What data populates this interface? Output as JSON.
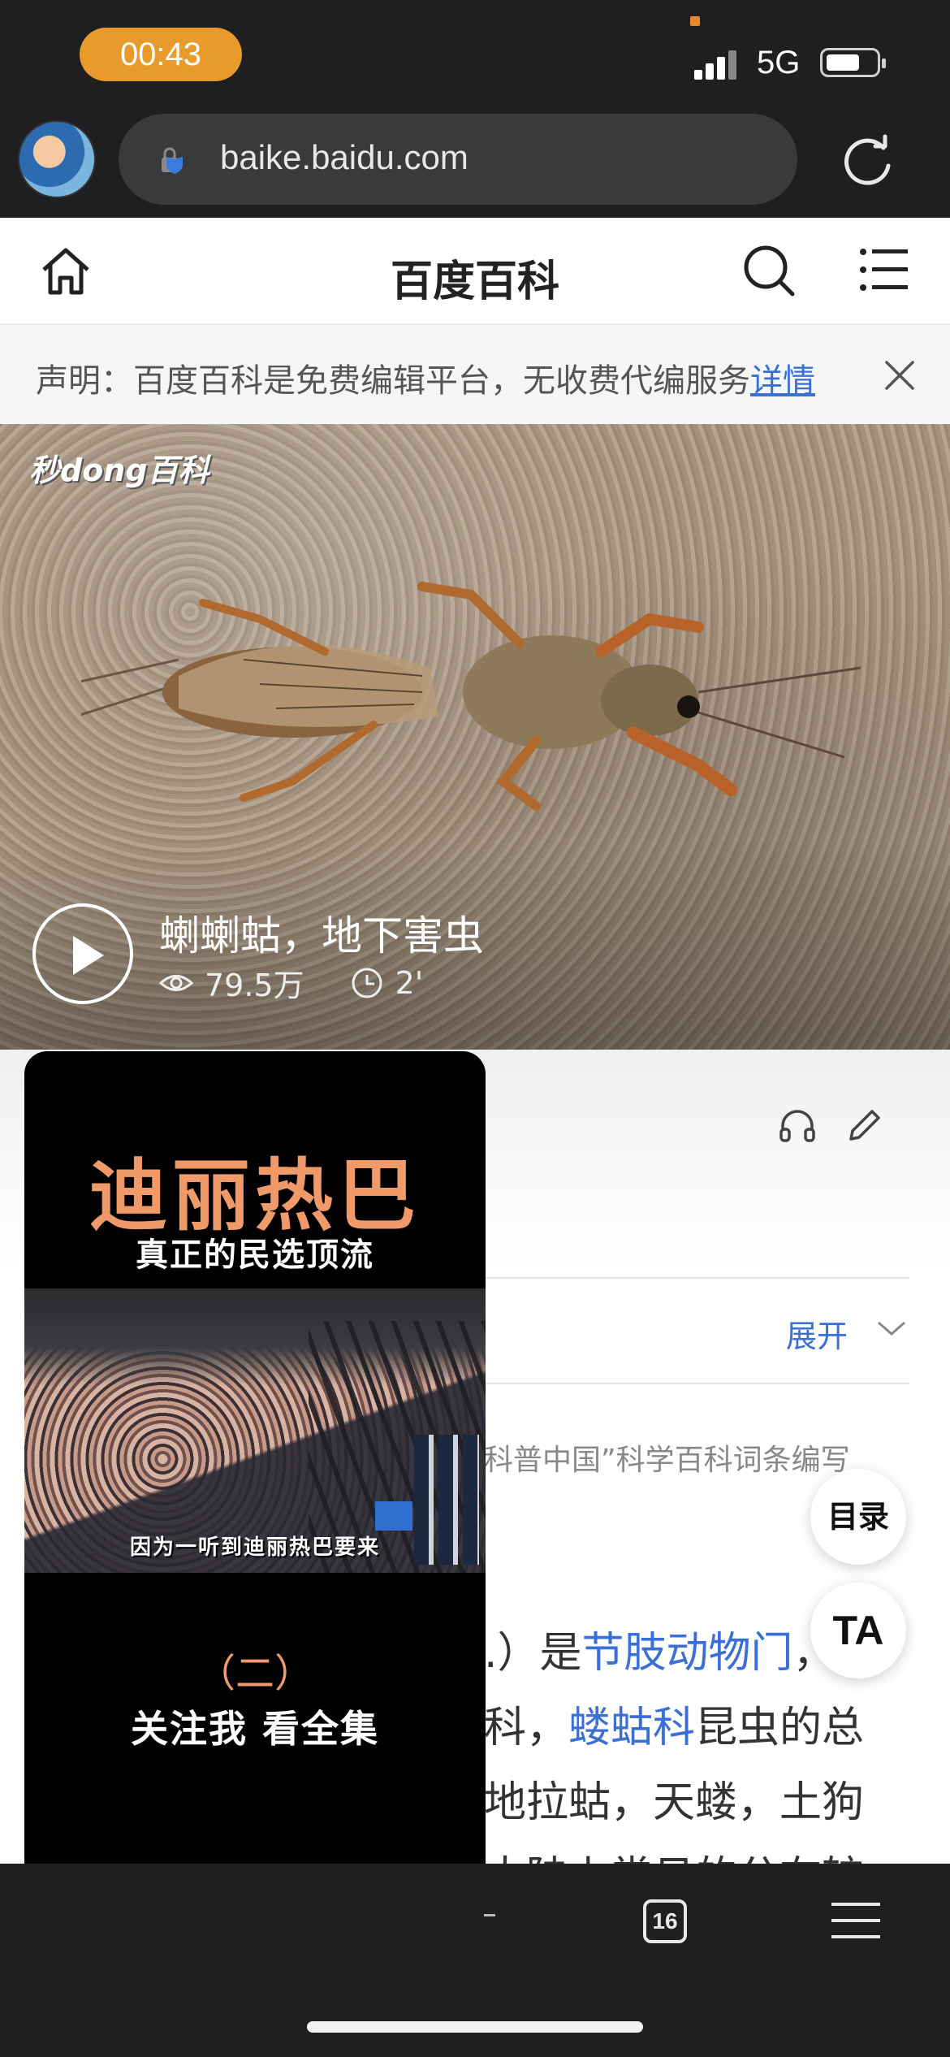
{
  "status": {
    "time": "00:43",
    "network": "5G"
  },
  "browser": {
    "url": "baike.baidu.com",
    "tab_count": "16"
  },
  "header": {
    "title": "百度百科"
  },
  "notice": {
    "text": "声明：百度百科是免费编辑平台，无收费代编服务",
    "link": "详情"
  },
  "video": {
    "watermark": "秒dong百科",
    "title": "蝲蝲蛄，地下害虫",
    "views": "79.5万",
    "duration": "2'"
  },
  "article": {
    "expand_label": "展开",
    "credit_partial": "科普中国”科学百科词条编写",
    "lines": [
      {
        "pre": ".）是",
        "link": "节肢动物门",
        "post": "，"
      },
      {
        "pre": "科，",
        "link": "蝼蛄科",
        "post": "昆虫的总"
      },
      {
        "pre": "地拉蛄，天蝼，土狗",
        "link": "",
        "post": ""
      },
      {
        "pre": "大陆上常见的分布较",
        "link": "",
        "post": ""
      }
    ]
  },
  "fab": {
    "toc": "目录",
    "ta": "TA"
  },
  "popup": {
    "title": "迪丽热巴",
    "subtitle": "真正的民选顶流",
    "caption": "因为一听到迪丽热巴要来",
    "part": "（二）",
    "cta": "关注我  看全集"
  }
}
